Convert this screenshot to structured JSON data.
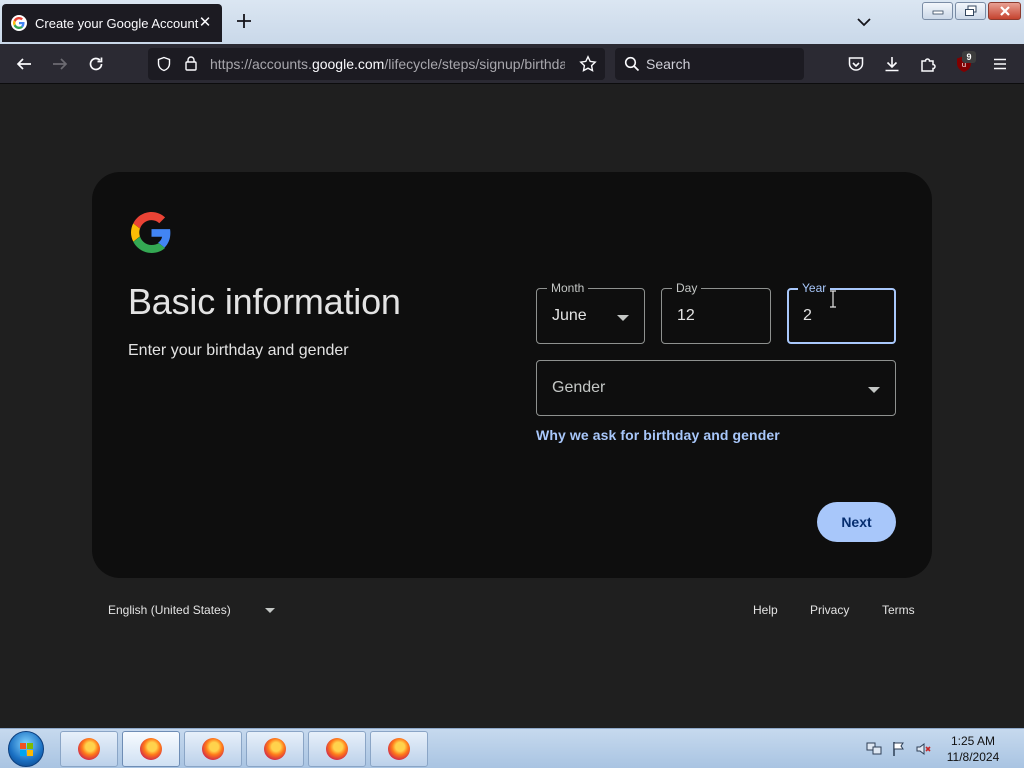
{
  "browser": {
    "tab": {
      "title": "Create your Google Account"
    },
    "url": {
      "prefix": "https://accounts.",
      "host": "google.com",
      "path": "/lifecycle/steps/signup/birthday"
    },
    "search_placeholder": "Search",
    "extension_badge": "9"
  },
  "page": {
    "heading": "Basic information",
    "subheading": "Enter your birthday and gender",
    "month": {
      "label": "Month",
      "value": "June"
    },
    "day": {
      "label": "Day",
      "value": "12"
    },
    "year": {
      "label": "Year",
      "value": "2"
    },
    "gender": {
      "placeholder": "Gender"
    },
    "why_link": "Why we ask for birthday and gender",
    "next_label": "Next"
  },
  "footer": {
    "language": "English (United States)",
    "links": [
      "Help",
      "Privacy",
      "Terms"
    ]
  },
  "taskbar": {
    "time": "1:25 AM",
    "date": "11/8/2024"
  },
  "colors": {
    "accent": "#a8c7fa",
    "card_bg": "#0e0e0e",
    "page_bg": "#1f1f1f"
  }
}
